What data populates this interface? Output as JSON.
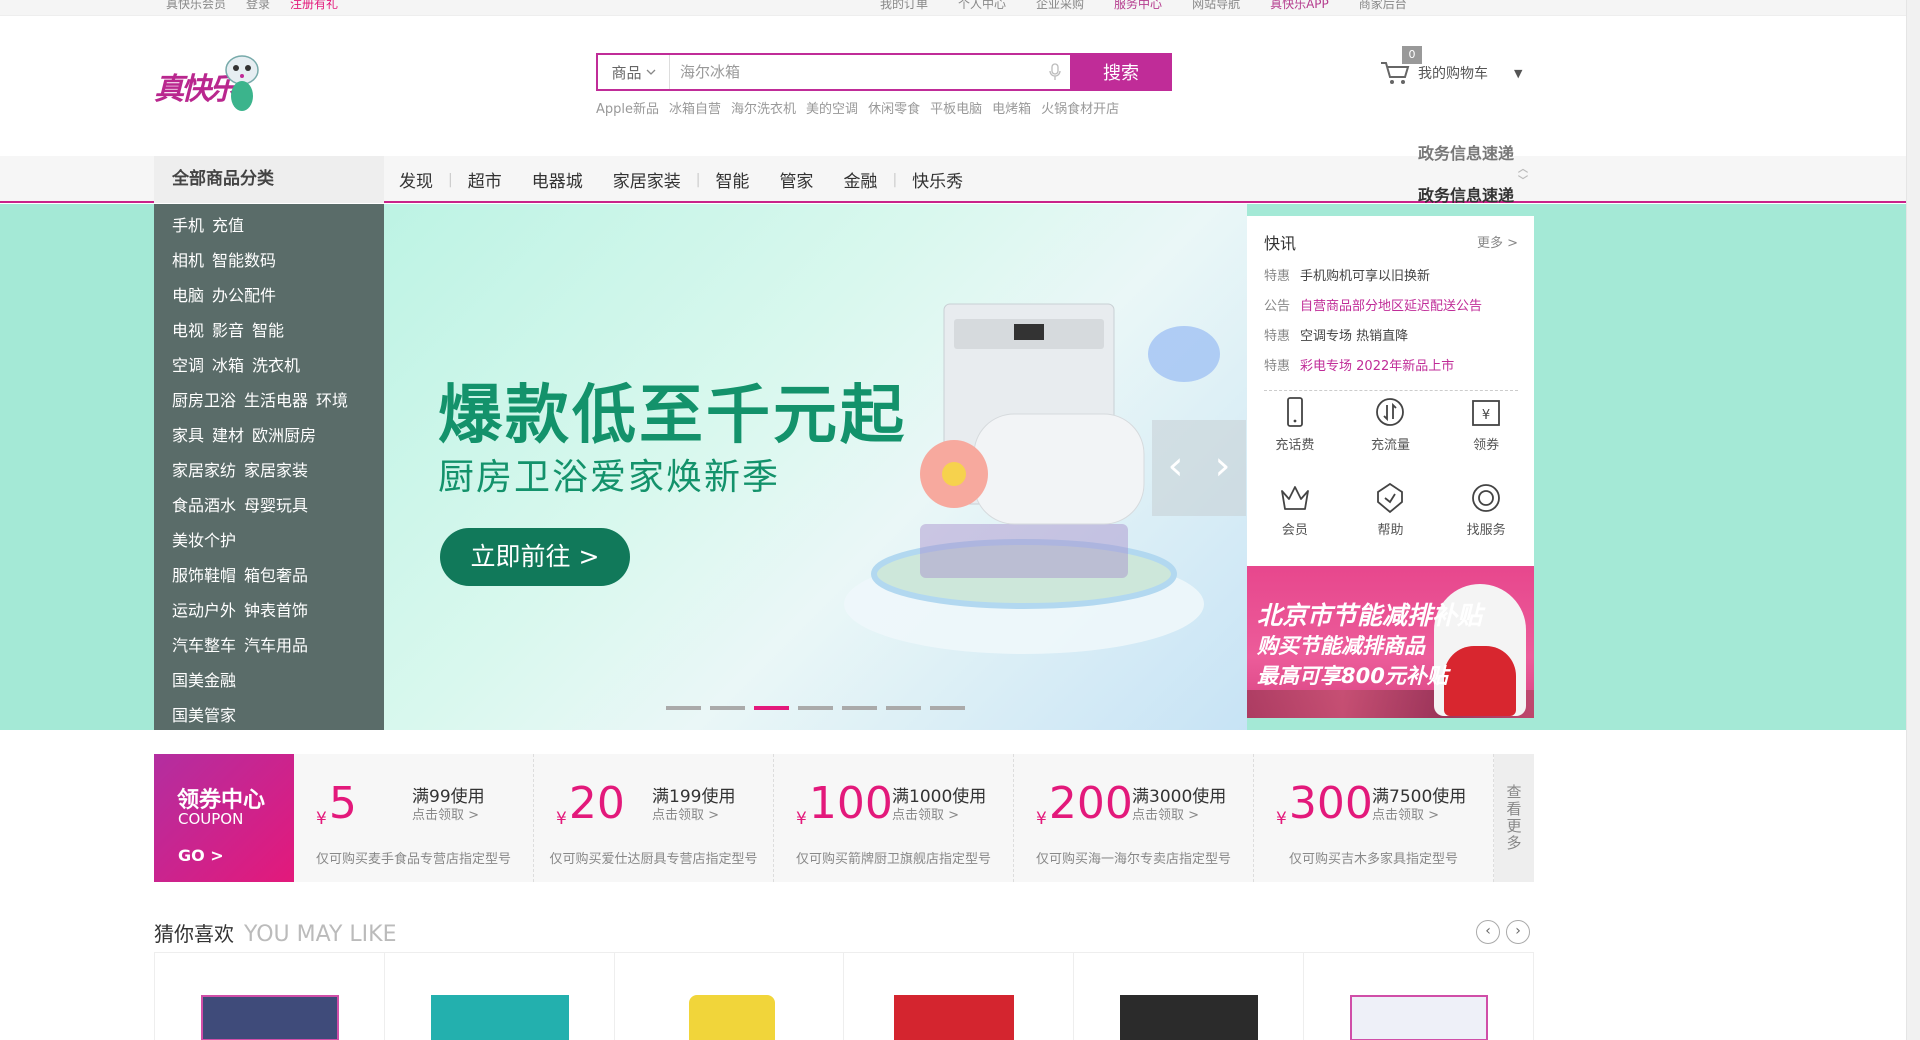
{
  "topbar": {
    "left": [
      "真快乐会员",
      "登录",
      "注册有礼"
    ],
    "right": [
      "我的订单",
      "个人中心",
      "企业采购",
      "服务中心",
      "网站导航",
      "真快乐APP",
      "商家后台"
    ]
  },
  "logo": {
    "text": "真快乐"
  },
  "search": {
    "category": "商品",
    "placeholder": "海尔冰箱",
    "button": "搜索",
    "hotwords": [
      "Apple新品",
      "冰箱自营",
      "海尔洗衣机",
      "美的空调",
      "休闲零食",
      "平板电脑",
      "电烤箱",
      "火锅食材开店"
    ]
  },
  "cart": {
    "label": "我的购物车",
    "count": "0"
  },
  "nav": {
    "all_categories": "全部商品分类",
    "items": [
      "发现",
      "超市",
      "电器城",
      "家居家装",
      "智能",
      "管家",
      "金融",
      "快乐秀"
    ],
    "ticker_prev": "政务信息速递",
    "ticker": "政务信息速递"
  },
  "sidebar": [
    [
      "手机",
      "充值"
    ],
    [
      "相机",
      "智能数码"
    ],
    [
      "电脑",
      "办公配件"
    ],
    [
      "电视",
      "影音",
      "智能"
    ],
    [
      "空调",
      "冰箱",
      "洗衣机"
    ],
    [
      "厨房卫浴",
      "生活电器",
      "环境"
    ],
    [
      "家具",
      "建材",
      "欧洲厨房"
    ],
    [
      "家居家纺",
      "家居家装"
    ],
    [
      "食品酒水",
      "母婴玩具"
    ],
    [
      "美妆个护"
    ],
    [
      "服饰鞋帽",
      "箱包奢品"
    ],
    [
      "运动户外",
      "钟表首饰"
    ],
    [
      "汽车整车",
      "汽车用品"
    ],
    [
      "国美金融"
    ],
    [
      "国美管家"
    ]
  ],
  "banner": {
    "headline": "爆款低至千元起",
    "subline": "厨房卫浴爱家焕新季",
    "cta": "立即前往 >",
    "slides_count": 7,
    "active_slide": 3
  },
  "news": {
    "title": "快讯",
    "more": "更多 >",
    "items": [
      {
        "tag": "特惠",
        "text": "手机购机可享以旧换新",
        "highlight": false
      },
      {
        "tag": "公告",
        "text": "自营商品部分地区延迟配送公告",
        "highlight": true
      },
      {
        "tag": "特惠",
        "text": "空调专场 热销直降",
        "highlight": false
      },
      {
        "tag": "特惠",
        "text": "彩电专场 2022年新品上市",
        "highlight": true
      }
    ]
  },
  "services": [
    {
      "icon": "phone-icon",
      "label": "充话费"
    },
    {
      "icon": "data-flow-icon",
      "label": "充流量"
    },
    {
      "icon": "coupon-icon",
      "label": "领券"
    },
    {
      "icon": "crown-icon",
      "label": "会员"
    },
    {
      "icon": "shield-icon",
      "label": "帮助"
    },
    {
      "icon": "refresh-icon",
      "label": "找服务"
    }
  ],
  "promo": {
    "line1": "北京市节能减排补贴",
    "line2": "购买节能减排商品",
    "line3": "最高可享800元补贴"
  },
  "coupon_center": {
    "title": "领券中心",
    "subtitle": "COUPON",
    "go": "GO >"
  },
  "coupons": [
    {
      "symbol": "¥",
      "amount": "5",
      "condition": "满99使用",
      "action": "点击领取 >",
      "desc": "仅可购买麦手食品专营店指定型号"
    },
    {
      "symbol": "¥",
      "amount": "20",
      "condition": "满199使用",
      "action": "点击领取 >",
      "desc": "仅可购买爱仕达厨具专营店指定型号"
    },
    {
      "symbol": "¥",
      "amount": "100",
      "condition": "满1000使用",
      "action": "点击领取 >",
      "desc": "仅可购买箭牌厨卫旗舰店指定型号"
    },
    {
      "symbol": "¥",
      "amount": "200",
      "condition": "满3000使用",
      "action": "点击领取 >",
      "desc": "仅可购买海一海尔专卖店指定型号"
    },
    {
      "symbol": "¥",
      "amount": "300",
      "condition": "满7500使用",
      "action": "点击领取 >",
      "desc": "仅可购买吉木多家具指定型号"
    }
  ],
  "coupon_more": "查看更多",
  "guess": {
    "title": "猜你喜欢",
    "subtitle": "YOU MAY LIKE"
  },
  "colors": {
    "brand": "#c02c98",
    "accent": "#e3197b",
    "green": "#13926b"
  }
}
